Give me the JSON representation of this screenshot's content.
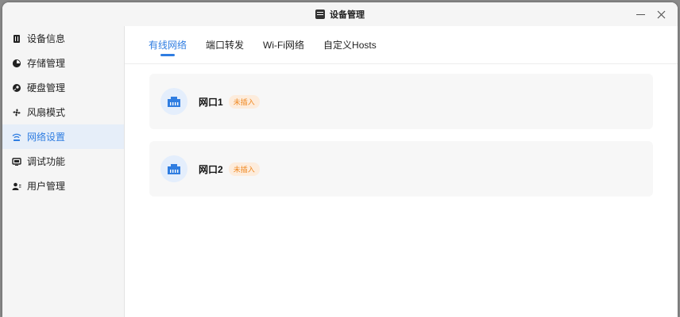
{
  "window": {
    "title": "设备管理"
  },
  "sidebar": {
    "items": [
      {
        "label": "设备信息",
        "icon": "device-info-icon",
        "active": false
      },
      {
        "label": "存储管理",
        "icon": "storage-pie-icon",
        "active": false
      },
      {
        "label": "硬盘管理",
        "icon": "disk-icon",
        "active": false
      },
      {
        "label": "风扇模式",
        "icon": "fan-icon",
        "active": false
      },
      {
        "label": "网络设置",
        "icon": "wifi-icon",
        "active": true
      },
      {
        "label": "调试功能",
        "icon": "monitor-icon",
        "active": false
      },
      {
        "label": "用户管理",
        "icon": "users-icon",
        "active": false
      }
    ]
  },
  "tabs": [
    {
      "label": "有线网络",
      "active": true
    },
    {
      "label": "端口转发",
      "active": false
    },
    {
      "label": "Wi-Fi网络",
      "active": false
    },
    {
      "label": "自定义Hosts",
      "active": false
    }
  ],
  "ports": [
    {
      "name": "网口1",
      "status": "未插入",
      "icon": "ethernet-port-icon"
    },
    {
      "name": "网口2",
      "status": "未插入",
      "icon": "ethernet-port-icon"
    }
  ],
  "colors": {
    "accent": "#2f7de1",
    "status_orange": "#f08a24",
    "status_bg": "#fdecdc"
  }
}
